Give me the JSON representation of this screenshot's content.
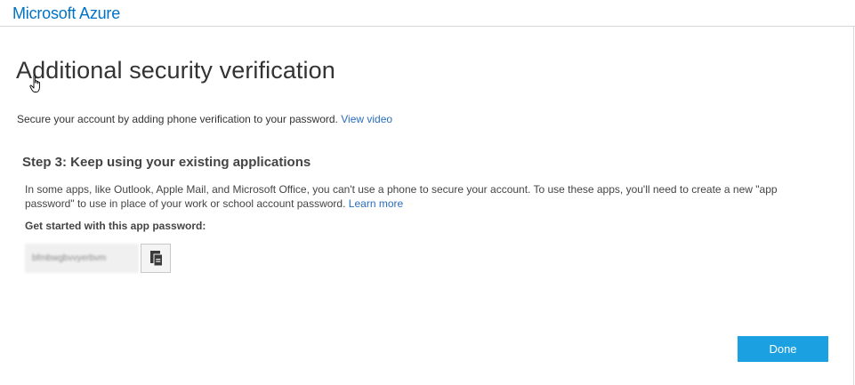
{
  "header": {
    "brand": "Microsoft Azure"
  },
  "main": {
    "title": "Additional security verification",
    "intro_text": "Secure your account by adding phone verification to your password.",
    "intro_link": "View video",
    "step_title": "Step 3: Keep using your existing applications",
    "description": "In some apps, like Outlook, Apple Mail, and Microsoft Office, you can't use a phone to secure your account. To use these apps, you'll need to create a new \"app password\" to use in place of your work or school account password.",
    "learn_more": "Learn more",
    "get_started_label": "Get started with this app password:",
    "app_password": "bfmbwgbvvyerbvm",
    "done_label": "Done"
  },
  "icons": {
    "cursor": "hand-pointer-icon",
    "copy": "copy-icon"
  },
  "colors": {
    "brand": "#0072c6",
    "link": "#2a6ebb",
    "done_button": "#1ba1e2"
  }
}
